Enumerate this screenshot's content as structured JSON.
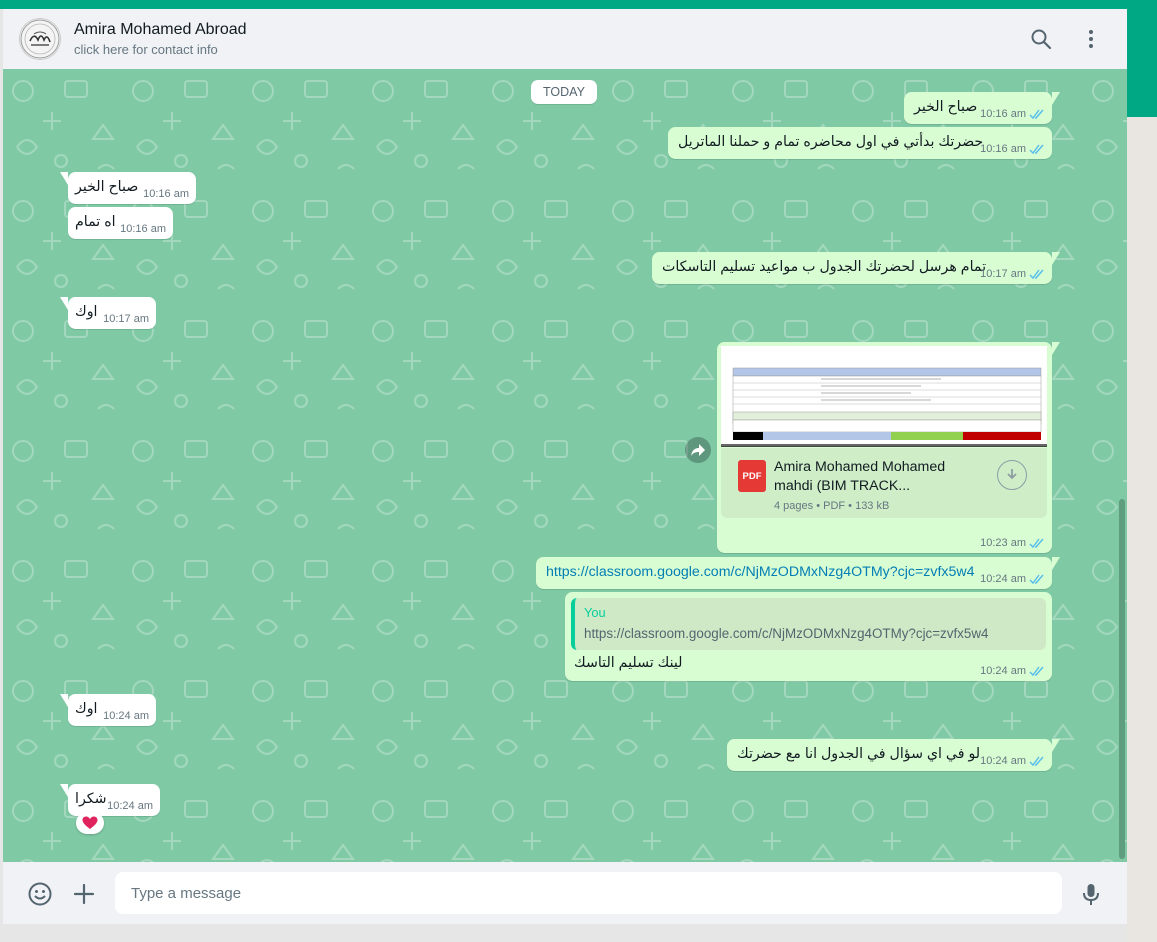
{
  "colors": {
    "accent": "#00a884",
    "chat_bg": "#7fcaa5",
    "outgoing": "#d9fdd3",
    "incoming": "#ffffff",
    "tick_read": "#53bdeb"
  },
  "header": {
    "contact_name": "Amira Mohamed Abroad",
    "contact_sub": "click here for contact info",
    "icons": [
      "search-icon",
      "menu-icon"
    ]
  },
  "chat": {
    "date_divider": "TODAY",
    "messages": [
      {
        "dir": "out",
        "text": "صباح الخير",
        "time": "10:16 am"
      },
      {
        "dir": "out",
        "text": "حضرتك بدأتي في اول محاضره تمام و حملنا الماتريل",
        "time": "10:16 am"
      },
      {
        "dir": "in",
        "text": "صباح الخير",
        "time": "10:16 am"
      },
      {
        "dir": "in",
        "text": "اه تمام",
        "time": "10:16 am"
      },
      {
        "dir": "out",
        "text": "تمام هرسل لحضرتك الجدول ب مواعيد تسليم التاسكات",
        "time": "10:17 am"
      },
      {
        "dir": "in",
        "text": "اوك",
        "time": "10:17 am"
      },
      {
        "dir": "out",
        "type": "document",
        "doc_title": "Amira Mohamed Mohamed mahdi (BIM TRACK...",
        "doc_badge": "PDF",
        "doc_info": "4 pages • PDF • 133 kB",
        "time": "10:23 am"
      },
      {
        "dir": "out",
        "text": "https://classroom.google.com/c/NjMzODMxNzg4OTMy?cjc=zvfx5w4",
        "time": "10:24 am"
      },
      {
        "dir": "out",
        "type": "reply",
        "quote_author": "You",
        "quote_text": "https://classroom.google.com/c/NjMzODMxNzg4OTMy?cjc=zvfx5w4",
        "text": "لينك تسليم التاسك",
        "time": "10:24 am"
      },
      {
        "dir": "in",
        "text": "اوك",
        "time": "10:24 am"
      },
      {
        "dir": "out",
        "text": "لو في اي سؤال في الجدول انا مع حضرتك",
        "time": "10:24 am"
      },
      {
        "dir": "in",
        "text": "شكرا",
        "time": "10:24 am",
        "reaction": "❤️"
      }
    ]
  },
  "footer": {
    "placeholder": "Type a message",
    "icons": [
      "emoji-icon",
      "attach-plus-icon",
      "microphone-icon"
    ]
  }
}
